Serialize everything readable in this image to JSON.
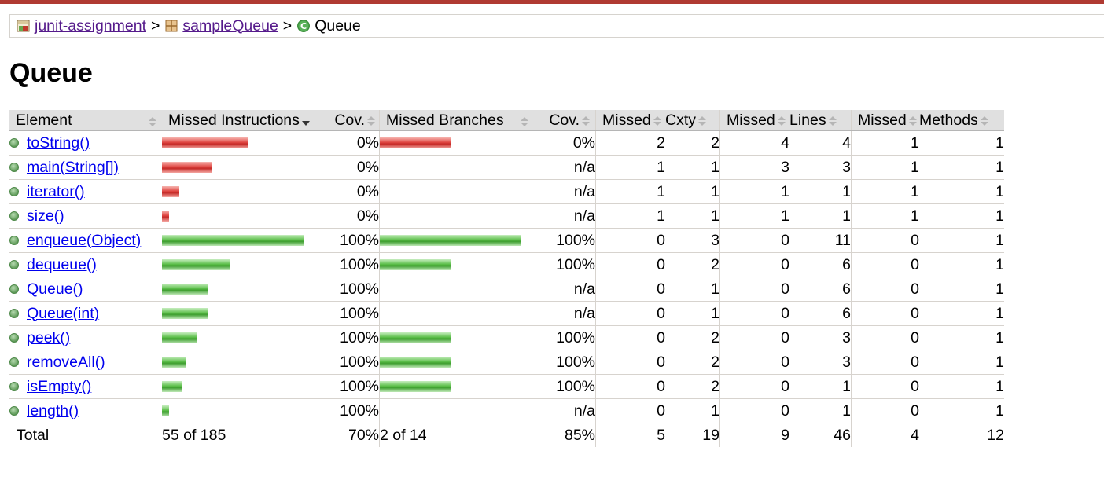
{
  "breadcrumb": {
    "project": "junit-assignment",
    "package": "sampleQueue",
    "class": "Queue",
    "separator": ">"
  },
  "title": "Queue",
  "colors": {
    "missed": "#e04743",
    "covered": "#5cbf4a",
    "accent": "#b03a32"
  },
  "icons": {
    "project": "report-icon",
    "package": "package-icon",
    "class": "class-icon",
    "method": "method-icon",
    "sort": "sort-icon"
  },
  "columns": {
    "element": "Element",
    "missed_instructions": "Missed Instructions",
    "cov1": "Cov.",
    "missed_branches": "Missed Branches",
    "cov2": "Cov.",
    "missed_cxty": "Missed",
    "cxty": "Cxty",
    "missed_lines": "Missed",
    "lines": "Lines",
    "missed_methods": "Missed",
    "methods": "Methods"
  },
  "rows": [
    {
      "name": "toString()",
      "instr_missed_fraction": 1.0,
      "instr_covered_fraction": 0,
      "instr_bar_scale": 0.61,
      "instr_cov": "0%",
      "branch_missed_fraction": 1.0,
      "branch_covered_fraction": 0,
      "branch_bar_scale": 0.5,
      "branch_cov": "0%",
      "missed_cxty": "2",
      "cxty": "2",
      "missed_lines": "4",
      "lines": "4",
      "missed_methods": "1",
      "methods": "1"
    },
    {
      "name": "main(String[])",
      "instr_missed_fraction": 1.0,
      "instr_covered_fraction": 0,
      "instr_bar_scale": 0.35,
      "instr_cov": "0%",
      "branch_missed_fraction": 0,
      "branch_covered_fraction": 0,
      "branch_bar_scale": 0,
      "branch_cov": "n/a",
      "missed_cxty": "1",
      "cxty": "1",
      "missed_lines": "3",
      "lines": "3",
      "missed_methods": "1",
      "methods": "1"
    },
    {
      "name": "iterator()",
      "instr_missed_fraction": 1.0,
      "instr_covered_fraction": 0,
      "instr_bar_scale": 0.12,
      "instr_cov": "0%",
      "branch_missed_fraction": 0,
      "branch_covered_fraction": 0,
      "branch_bar_scale": 0,
      "branch_cov": "n/a",
      "missed_cxty": "1",
      "cxty": "1",
      "missed_lines": "1",
      "lines": "1",
      "missed_methods": "1",
      "methods": "1"
    },
    {
      "name": "size()",
      "instr_missed_fraction": 1.0,
      "instr_covered_fraction": 0,
      "instr_bar_scale": 0.05,
      "instr_cov": "0%",
      "branch_missed_fraction": 0,
      "branch_covered_fraction": 0,
      "branch_bar_scale": 0,
      "branch_cov": "n/a",
      "missed_cxty": "1",
      "cxty": "1",
      "missed_lines": "1",
      "lines": "1",
      "missed_methods": "1",
      "methods": "1"
    },
    {
      "name": "enqueue(Object)",
      "instr_missed_fraction": 0,
      "instr_covered_fraction": 1.0,
      "instr_bar_scale": 1.0,
      "instr_cov": "100%",
      "branch_missed_fraction": 0,
      "branch_covered_fraction": 1.0,
      "branch_bar_scale": 1.0,
      "branch_cov": "100%",
      "missed_cxty": "0",
      "cxty": "3",
      "missed_lines": "0",
      "lines": "11",
      "missed_methods": "0",
      "methods": "1"
    },
    {
      "name": "dequeue()",
      "instr_missed_fraction": 0,
      "instr_covered_fraction": 1.0,
      "instr_bar_scale": 0.48,
      "instr_cov": "100%",
      "branch_missed_fraction": 0,
      "branch_covered_fraction": 1.0,
      "branch_bar_scale": 0.5,
      "branch_cov": "100%",
      "missed_cxty": "0",
      "cxty": "2",
      "missed_lines": "0",
      "lines": "6",
      "missed_methods": "0",
      "methods": "1"
    },
    {
      "name": "Queue()",
      "instr_missed_fraction": 0,
      "instr_covered_fraction": 1.0,
      "instr_bar_scale": 0.32,
      "instr_cov": "100%",
      "branch_missed_fraction": 0,
      "branch_covered_fraction": 0,
      "branch_bar_scale": 0,
      "branch_cov": "n/a",
      "missed_cxty": "0",
      "cxty": "1",
      "missed_lines": "0",
      "lines": "6",
      "missed_methods": "0",
      "methods": "1"
    },
    {
      "name": "Queue(int)",
      "instr_missed_fraction": 0,
      "instr_covered_fraction": 1.0,
      "instr_bar_scale": 0.32,
      "instr_cov": "100%",
      "branch_missed_fraction": 0,
      "branch_covered_fraction": 0,
      "branch_bar_scale": 0,
      "branch_cov": "n/a",
      "missed_cxty": "0",
      "cxty": "1",
      "missed_lines": "0",
      "lines": "6",
      "missed_methods": "0",
      "methods": "1"
    },
    {
      "name": "peek()",
      "instr_missed_fraction": 0,
      "instr_covered_fraction": 1.0,
      "instr_bar_scale": 0.25,
      "instr_cov": "100%",
      "branch_missed_fraction": 0,
      "branch_covered_fraction": 1.0,
      "branch_bar_scale": 0.5,
      "branch_cov": "100%",
      "missed_cxty": "0",
      "cxty": "2",
      "missed_lines": "0",
      "lines": "3",
      "missed_methods": "0",
      "methods": "1"
    },
    {
      "name": "removeAll()",
      "instr_missed_fraction": 0,
      "instr_covered_fraction": 1.0,
      "instr_bar_scale": 0.17,
      "instr_cov": "100%",
      "branch_missed_fraction": 0,
      "branch_covered_fraction": 1.0,
      "branch_bar_scale": 0.5,
      "branch_cov": "100%",
      "missed_cxty": "0",
      "cxty": "2",
      "missed_lines": "0",
      "lines": "3",
      "missed_methods": "0",
      "methods": "1"
    },
    {
      "name": "isEmpty()",
      "instr_missed_fraction": 0,
      "instr_covered_fraction": 1.0,
      "instr_bar_scale": 0.14,
      "instr_cov": "100%",
      "branch_missed_fraction": 0,
      "branch_covered_fraction": 1.0,
      "branch_bar_scale": 0.5,
      "branch_cov": "100%",
      "missed_cxty": "0",
      "cxty": "2",
      "missed_lines": "0",
      "lines": "1",
      "missed_methods": "0",
      "methods": "1"
    },
    {
      "name": "length()",
      "instr_missed_fraction": 0,
      "instr_covered_fraction": 1.0,
      "instr_bar_scale": 0.05,
      "instr_cov": "100%",
      "branch_missed_fraction": 0,
      "branch_covered_fraction": 0,
      "branch_bar_scale": 0,
      "branch_cov": "n/a",
      "missed_cxty": "0",
      "cxty": "1",
      "missed_lines": "0",
      "lines": "1",
      "missed_methods": "0",
      "methods": "1"
    }
  ],
  "total": {
    "label": "Total",
    "instr": "55 of 185",
    "instr_cov": "70%",
    "branch": "2 of 14",
    "branch_cov": "85%",
    "missed_cxty": "5",
    "cxty": "19",
    "missed_lines": "9",
    "lines": "46",
    "missed_methods": "4",
    "methods": "12"
  }
}
